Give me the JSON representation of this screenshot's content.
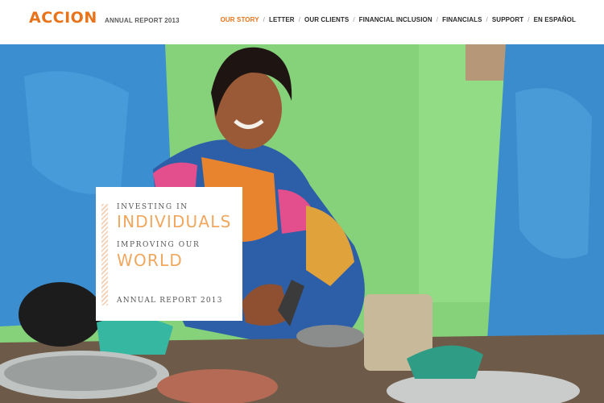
{
  "brand": {
    "logo": "ACCION",
    "accent": "#e8731a"
  },
  "header": {
    "report_label": "ANNUAL REPORT 2013"
  },
  "nav": {
    "items": [
      {
        "label": "OUR STORY",
        "active": true
      },
      {
        "label": "LETTER"
      },
      {
        "label": "OUR CLIENTS"
      },
      {
        "label": "FINANCIAL INCLUSION"
      },
      {
        "label": "FINANCIALS"
      },
      {
        "label": "SUPPORT"
      },
      {
        "label": "EN ESPAÑOL"
      }
    ],
    "separator": "/"
  },
  "hero": {
    "card": {
      "line1": "INVESTING IN",
      "line2": "INDIVIDUALS",
      "line3": "IMPROVING OUR",
      "line4": "WORLD",
      "line5": "ANNUAL REPORT 2013"
    }
  }
}
